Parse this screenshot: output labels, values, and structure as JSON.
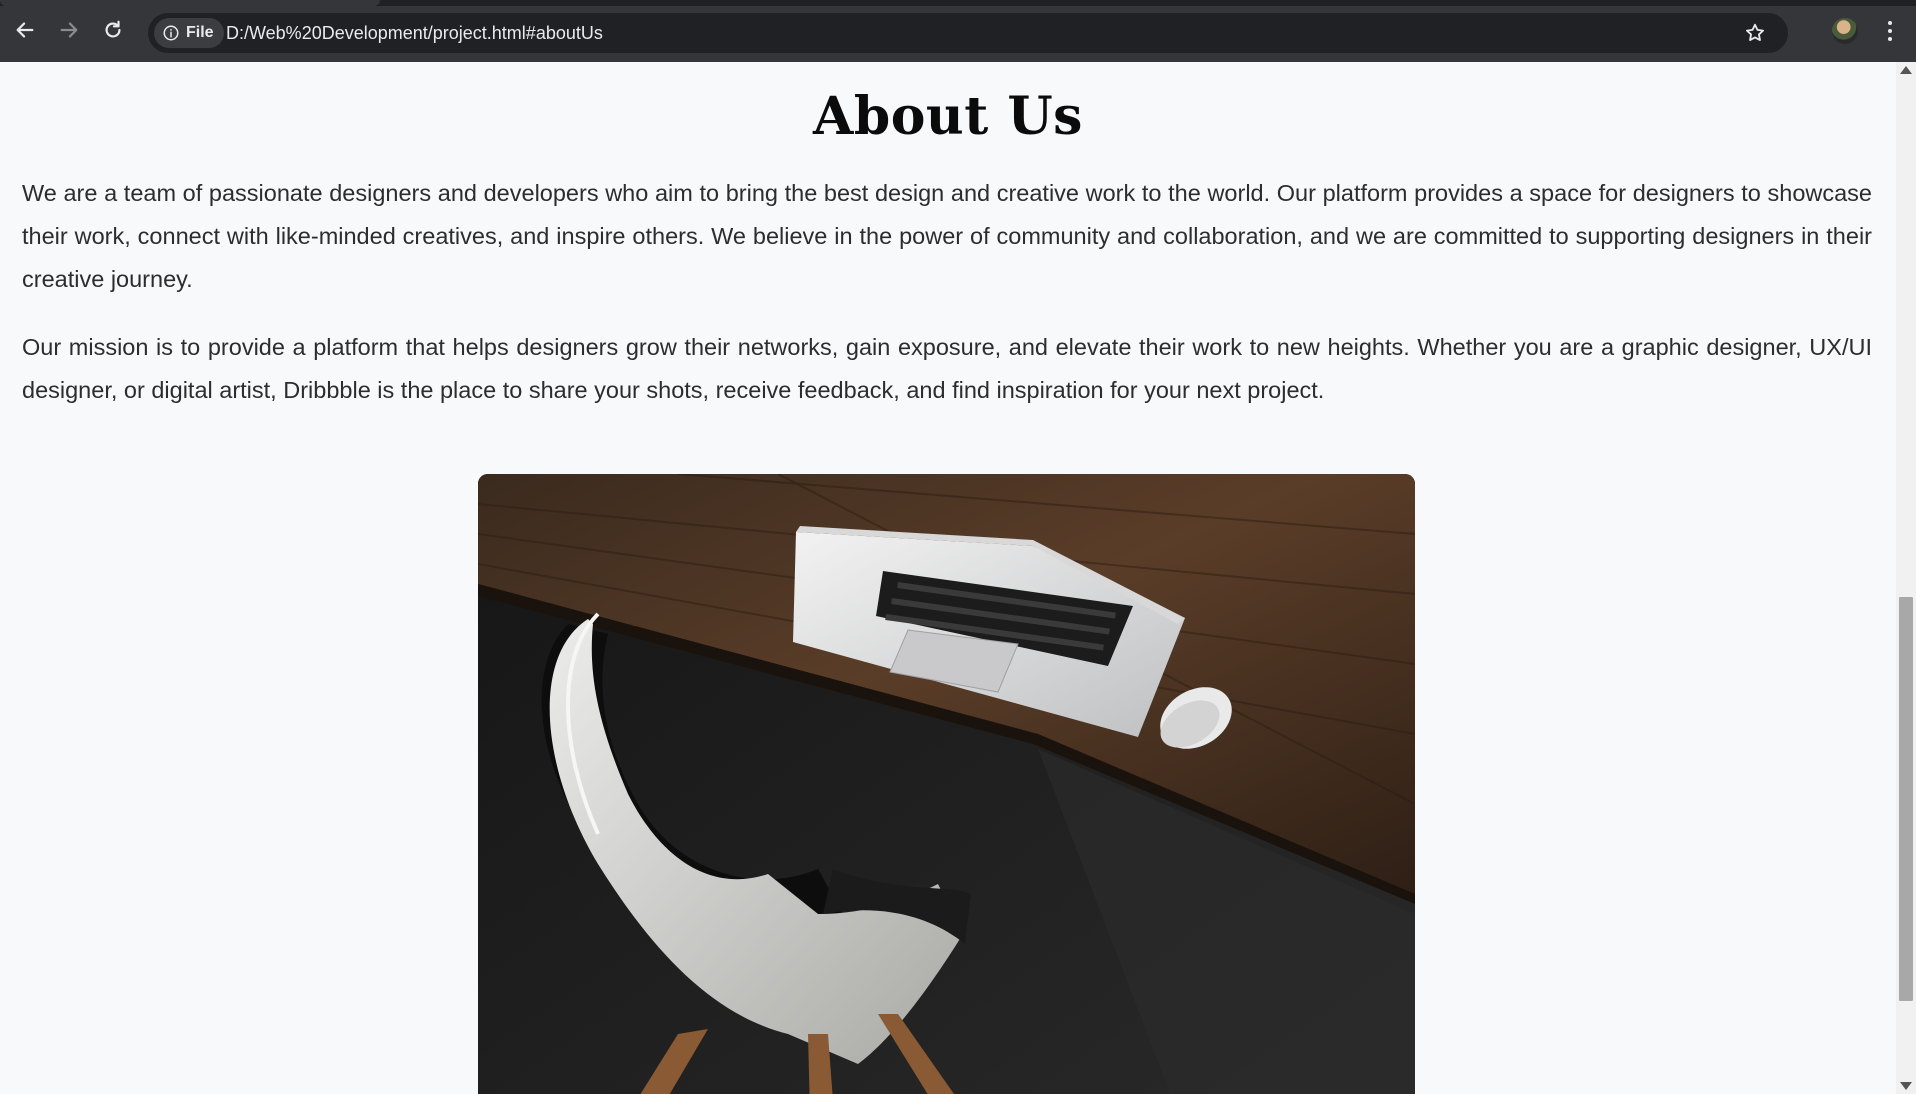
{
  "browser": {
    "address_chip_label": "File",
    "url": "D:/Web%20Development/project.html#aboutUs",
    "icons": [
      "back-arrow-icon",
      "forward-arrow-icon",
      "reload-icon",
      "info-icon",
      "star-icon",
      "profile-avatar",
      "kebab-menu-icon"
    ]
  },
  "about": {
    "title": "About Us",
    "paragraph_1": "We are a team of passionate designers and developers who aim to bring the best design and creative work to the world. Our platform provides a space for designers to showcase their work, connect with like-minded creatives, and inspire others. We believe in the power of community and collaboration, and we are committed to supporting designers in their creative journey.",
    "paragraph_2": "Our mission is to provide a platform that helps designers grow their networks, gain exposure, and elevate their work to new heights. Whether you are a graphic designer, UX/UI designer, or digital artist, Dribbble is the place to share your shots, receive feedback, and find inspiration for your next project."
  },
  "colors": {
    "chrome_bg": "#35363a",
    "omnibox_bg": "#202124",
    "page_bg": "#f8f9fb",
    "heading": "#0b0b0b",
    "body_text": "#2d2d2d"
  }
}
